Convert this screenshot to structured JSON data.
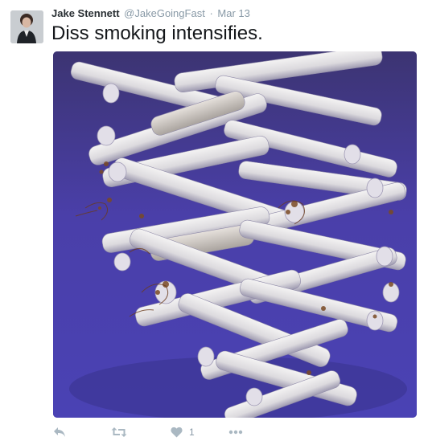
{
  "tweet": {
    "author": {
      "fullname": "Jake Stennett",
      "username": "@JakeGoingFast"
    },
    "separator": "·",
    "timestamp": "Mar 13",
    "text": "Diss smoking intensifies.",
    "actions": {
      "like_count": "1"
    }
  },
  "colors": {
    "meta_text": "#8899a6",
    "action_icon": "#aab8c2",
    "media_background": "#4a40a6"
  }
}
